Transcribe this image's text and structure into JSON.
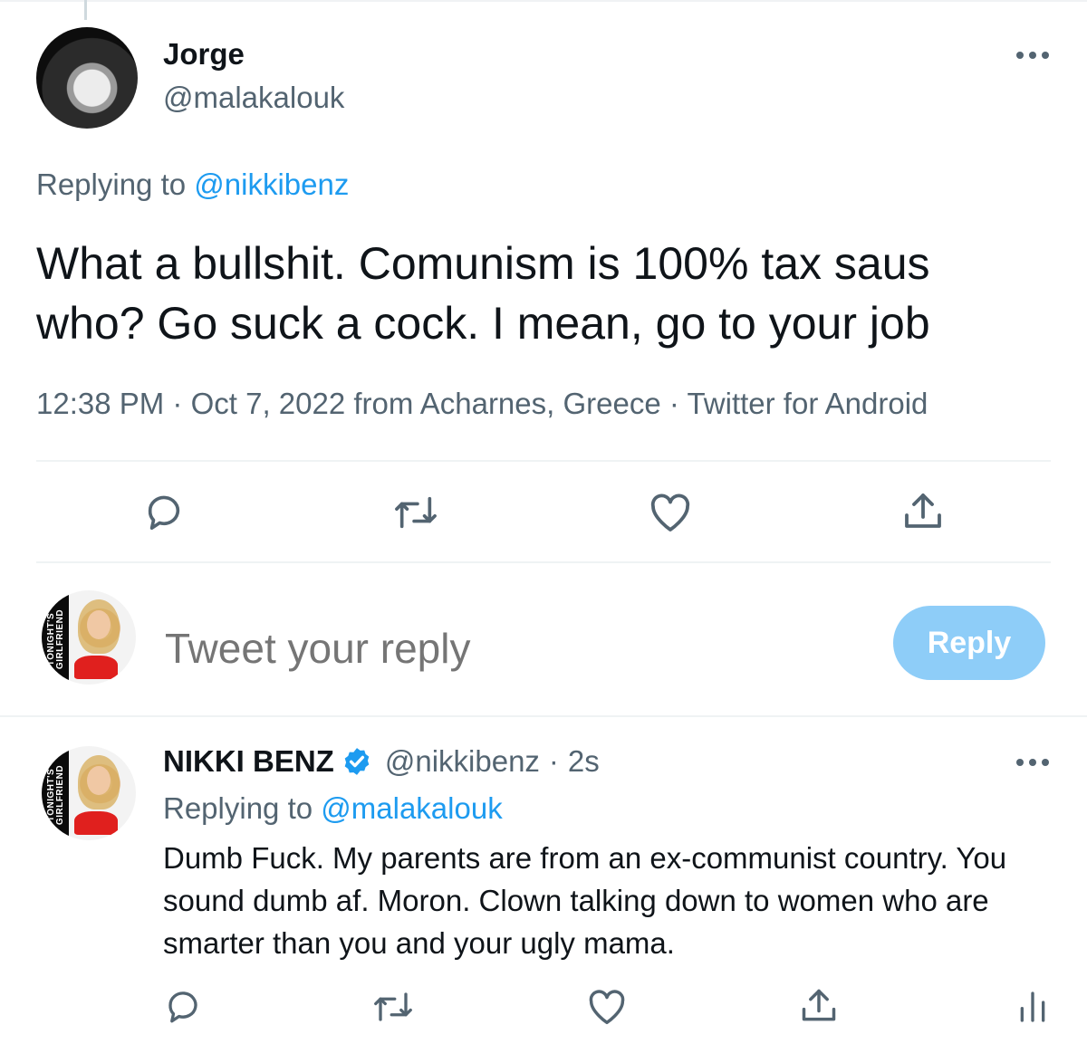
{
  "main_tweet": {
    "author_name": "Jorge",
    "author_handle": "@malakalouk",
    "replying_prefix": "Replying to",
    "replying_handle": "@nikkibenz",
    "text_line1": "What a bullshit. Comunism is 100% tax saus",
    "text_line2": "who? Go suck a cock. I mean, go to your job",
    "time": "12:38 PM",
    "date": "Oct 7, 2022",
    "location": "from Acharnes, Greece",
    "source": "Twitter for Android",
    "sep": "·",
    "actions": [
      "reply-icon",
      "retweet-icon",
      "like-icon",
      "share-icon"
    ]
  },
  "composer": {
    "placeholder": "Tweet your reply",
    "button_label": "Reply",
    "avatar_text": "TONIGHT'S GIRLFRIEND"
  },
  "reply_tweet": {
    "author_name": "NIKKI BENZ",
    "author_handle": "@nikkibenz",
    "sep": "·",
    "time_ago": "2s",
    "replying_prefix": "Replying to",
    "replying_handle": "@malakalouk",
    "text_line1": "Dumb Fuck. My parents are from an ex-communist country. You",
    "text_line2": "sound dumb af. Moron. Clown talking down to women who are",
    "text_line3": "smarter than you and your ugly mama.",
    "avatar_text": "TONIGHT'S GIRLFRIEND",
    "actions": [
      "reply-icon",
      "retweet-icon",
      "like-icon",
      "share-icon",
      "analytics-icon"
    ]
  },
  "colors": {
    "text": "#0f1419",
    "muted": "#536471",
    "link": "#1d9bf0",
    "reply_button": "#8ecdf8",
    "divider": "#eff3f4"
  }
}
